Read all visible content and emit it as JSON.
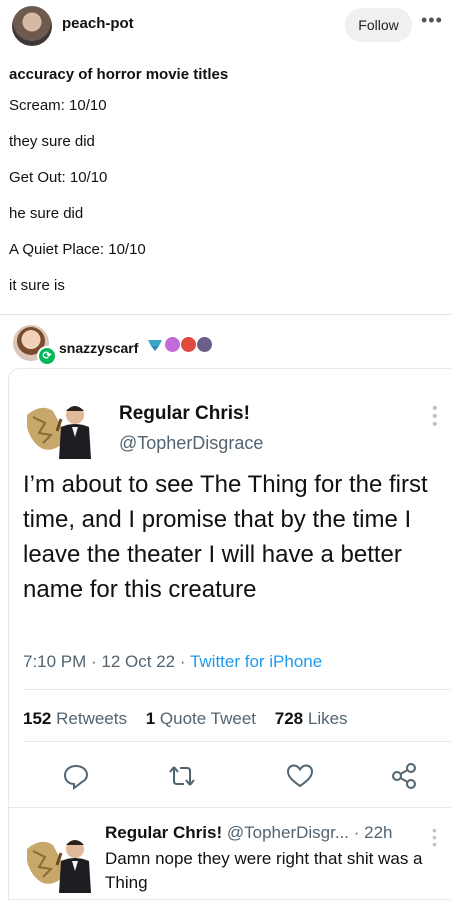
{
  "post": {
    "username": "peach-pot",
    "follow_label": "Follow",
    "more_label": "•••",
    "title": "accuracy of horror movie titles",
    "lines": [
      "Scream: 10/10",
      "they sure did",
      "Get Out: 10/10",
      "he sure did",
      "A Quiet Place: 10/10",
      "it sure is"
    ]
  },
  "reblog": {
    "username": "snazzyscarf",
    "badge_icon": "reblog-icon"
  },
  "tweet": {
    "name": "Regular Chris!",
    "handle": "@TopherDisgrace",
    "text": "I’m about to see The Thing for the first time, and I promise that by the time I leave the theater I will have a better name for this creature",
    "time_date": "7:10 PM · 12 Oct 22 · ",
    "via": "Twitter for iPhone",
    "stats": {
      "retweets_count": "152",
      "retweets_label": "Retweets",
      "quotes_count": "1",
      "quotes_label": "Quote Tweet",
      "likes_count": "728",
      "likes_label": "Likes"
    },
    "actions": [
      "reply-icon",
      "retweet-icon",
      "like-icon",
      "share-icon"
    ]
  },
  "reply": {
    "name": "Regular Chris!",
    "handle": "@TopherDisgr...",
    "time": "· 22h",
    "text": "Damn nope they were right that shit was a Thing"
  },
  "colors": {
    "twitter_blue": "#1d9bf0",
    "muted": "#536471",
    "reblog_green": "#00b956"
  }
}
